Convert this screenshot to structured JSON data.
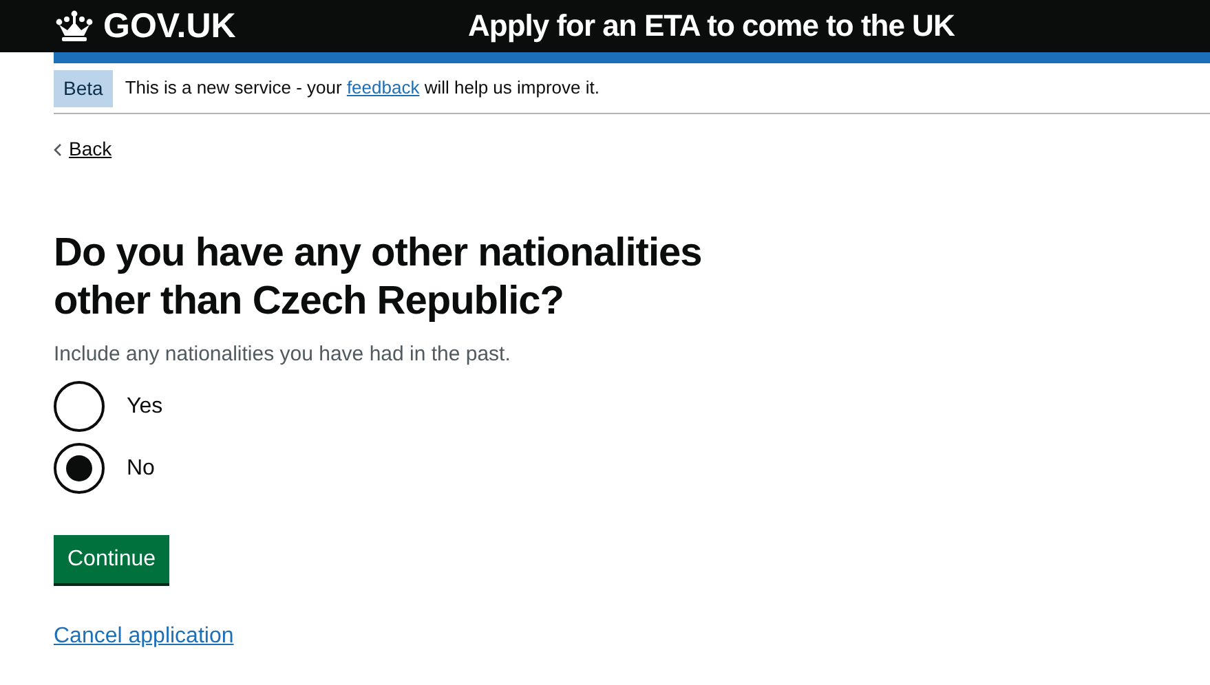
{
  "header": {
    "logo": "GOV.UK",
    "service_name": "Apply for an ETA to come to the UK"
  },
  "phase_banner": {
    "tag": "Beta",
    "text_before": "This is a new service - your",
    "link": "feedback",
    "text_after": "will help us improve it."
  },
  "back_link": "Back",
  "question": {
    "heading": "Do you have any other nationalities other than Czech Republic?",
    "hint": "Include any nationalities you have had in the past.",
    "options": [
      {
        "label": "Yes",
        "selected": false
      },
      {
        "label": "No",
        "selected": true
      }
    ]
  },
  "continue_button": "Continue",
  "cancel_link": "Cancel application"
}
